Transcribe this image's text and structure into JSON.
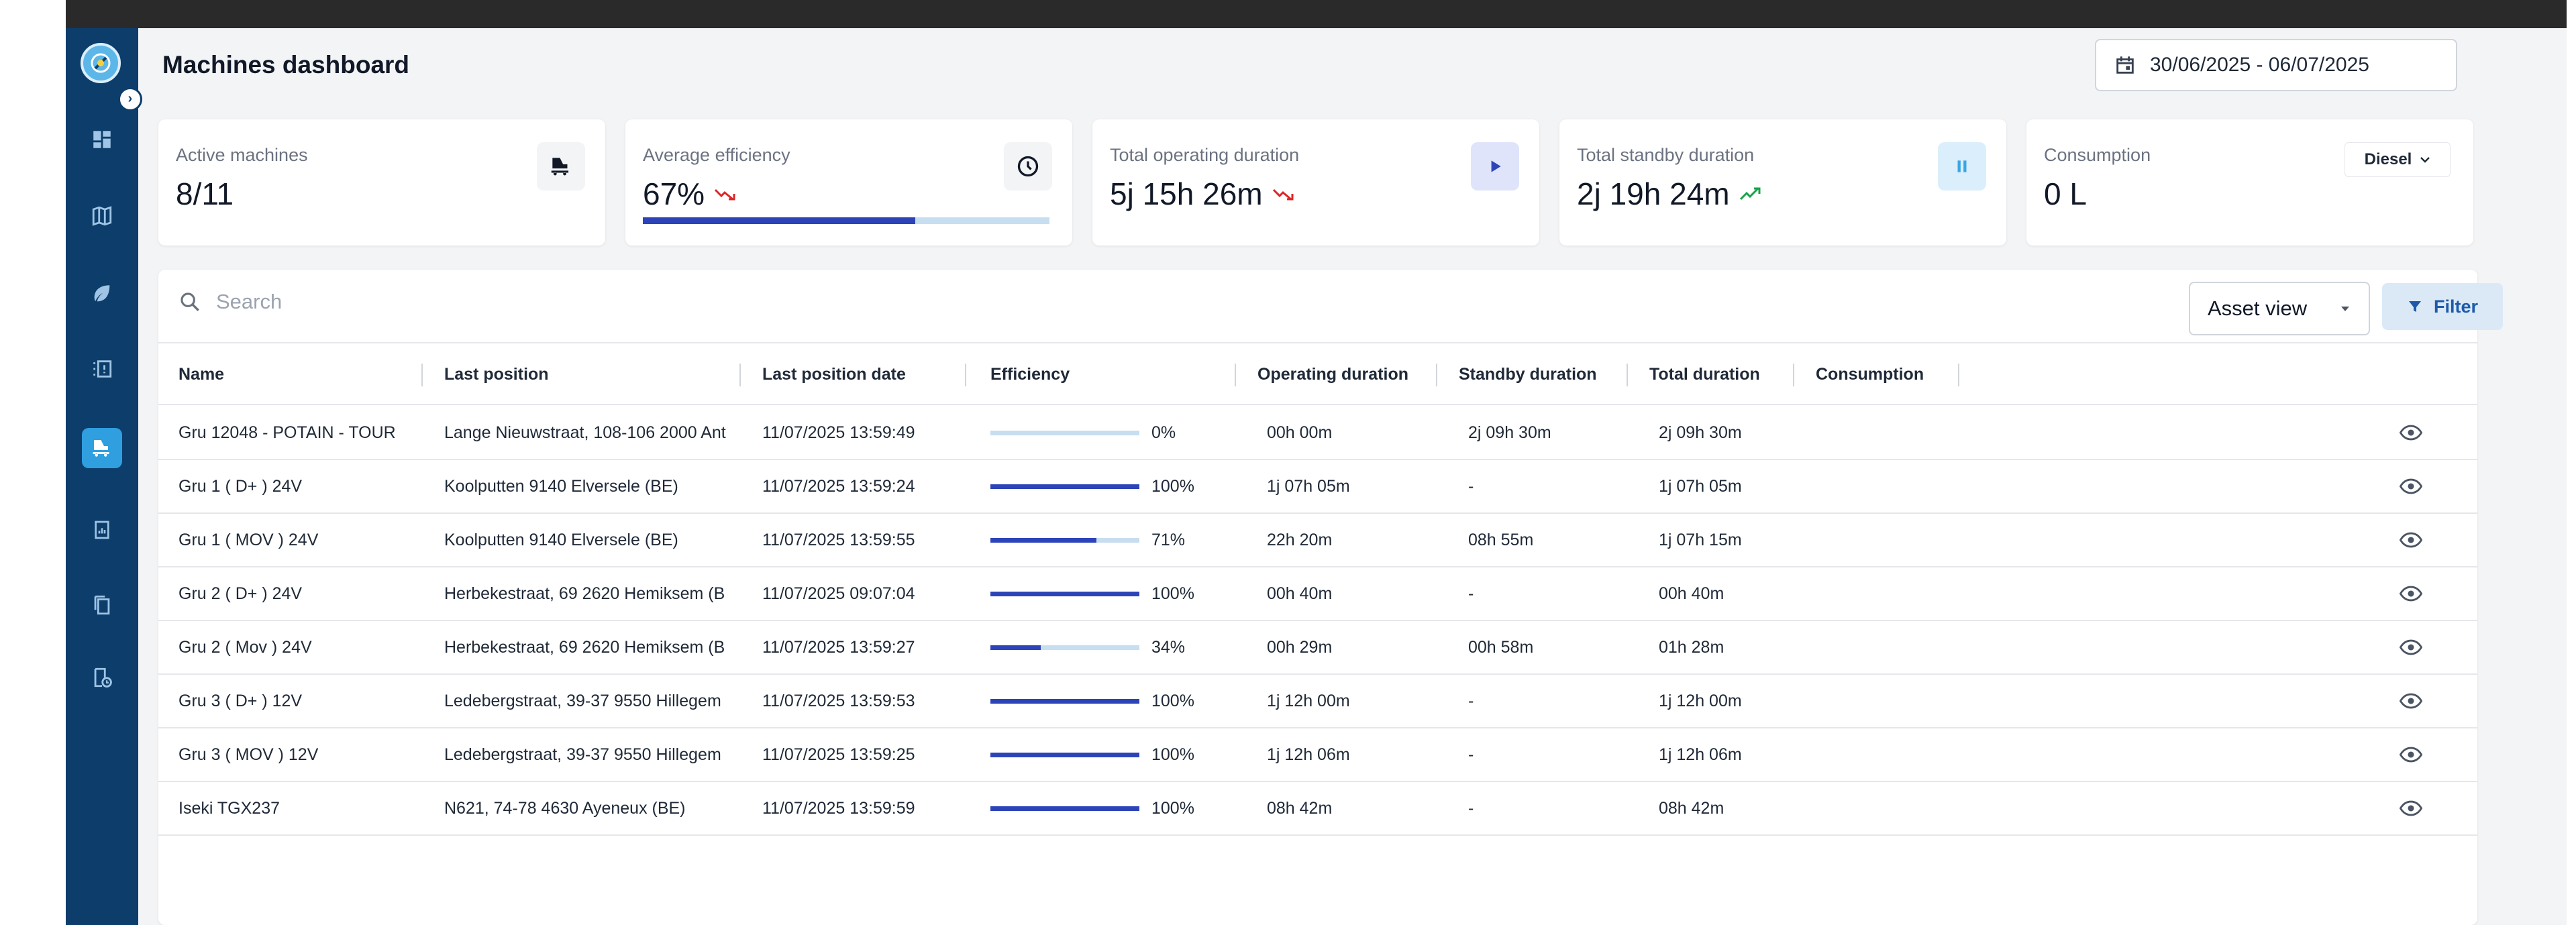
{
  "header": {
    "title": "Machines dashboard",
    "date_range": "30/06/2025 - 06/07/2025"
  },
  "sidebar": {
    "items": [
      {
        "icon": "dashboard-icon"
      },
      {
        "icon": "map-icon"
      },
      {
        "icon": "leaf-icon"
      },
      {
        "icon": "alerts-list-icon"
      },
      {
        "icon": "machines-icon",
        "active": true
      },
      {
        "icon": "report-icon"
      },
      {
        "icon": "documents-icon"
      },
      {
        "icon": "history-icon"
      }
    ]
  },
  "kpis": {
    "active_machines": {
      "label": "Active machines",
      "value": "8/11",
      "icon": "machine-icon"
    },
    "avg_efficiency": {
      "label": "Average efficiency",
      "value": "67%",
      "trend": "down",
      "icon": "clock-icon",
      "progress": 0.67
    },
    "operating": {
      "label": "Total operating duration",
      "value": "5j 15h 26m",
      "trend": "down",
      "icon": "play-icon"
    },
    "standby": {
      "label": "Total standby duration",
      "value": "2j 19h 24m",
      "trend": "up",
      "icon": "pause-icon"
    },
    "consumption": {
      "label": "Consumption",
      "value": "0 L",
      "fuel": "Diesel"
    }
  },
  "toolbar": {
    "search_placeholder": "Search",
    "view": "Asset view",
    "filter_label": "Filter"
  },
  "table": {
    "columns": [
      "Name",
      "Last position",
      "Last position date",
      "Efficiency",
      "Operating duration",
      "Standby duration",
      "Total duration",
      "Consumption"
    ],
    "rows": [
      {
        "name": "Gru 12048 - POTAIN - TOUR",
        "position": "Lange Nieuwstraat, 108-106 2000 Ant",
        "date": "11/07/2025 13:59:49",
        "efficiency": 0,
        "efficiency_label": "0%",
        "operating": "00h 00m",
        "standby": "2j 09h 30m",
        "total": "2j 09h 30m",
        "consumption": ""
      },
      {
        "name": "Gru 1 ( D+ ) 24V",
        "position": "Koolputten 9140 Elversele (BE)",
        "date": "11/07/2025 13:59:24",
        "efficiency": 100,
        "efficiency_label": "100%",
        "operating": "1j 07h 05m",
        "standby": "-",
        "total": "1j 07h 05m",
        "consumption": ""
      },
      {
        "name": "Gru 1 ( MOV ) 24V",
        "position": "Koolputten 9140 Elversele (BE)",
        "date": "11/07/2025 13:59:55",
        "efficiency": 71,
        "efficiency_label": "71%",
        "operating": "22h 20m",
        "standby": "08h 55m",
        "total": "1j 07h 15m",
        "consumption": ""
      },
      {
        "name": "Gru 2 ( D+ ) 24V",
        "position": "Herbekestraat, 69 2620 Hemiksem (BI",
        "date": "11/07/2025 09:07:04",
        "efficiency": 100,
        "efficiency_label": "100%",
        "operating": "00h 40m",
        "standby": "-",
        "total": "00h 40m",
        "consumption": ""
      },
      {
        "name": "Gru 2 ( Mov ) 24V",
        "position": "Herbekestraat, 69 2620 Hemiksem (BI",
        "date": "11/07/2025 13:59:27",
        "efficiency": 34,
        "efficiency_label": "34%",
        "operating": "00h 29m",
        "standby": "00h 58m",
        "total": "01h 28m",
        "consumption": ""
      },
      {
        "name": "Gru 3 ( D+ ) 12V",
        "position": "Ledebergstraat, 39-37 9550 Hillegem (",
        "date": "11/07/2025 13:59:53",
        "efficiency": 100,
        "efficiency_label": "100%",
        "operating": "1j 12h 00m",
        "standby": "-",
        "total": "1j 12h 00m",
        "consumption": ""
      },
      {
        "name": "Gru 3 ( MOV ) 12V",
        "position": "Ledebergstraat, 39-37 9550 Hillegem (",
        "date": "11/07/2025 13:59:25",
        "efficiency": 100,
        "efficiency_label": "100%",
        "operating": "1j 12h 06m",
        "standby": "-",
        "total": "1j 12h 06m",
        "consumption": ""
      },
      {
        "name": "Iseki TGX237",
        "position": "N621, 74-78 4630 Ayeneux (BE)",
        "date": "11/07/2025 13:59:59",
        "efficiency": 100,
        "efficiency_label": "100%",
        "operating": "08h 42m",
        "standby": "-",
        "total": "08h 42m",
        "consumption": ""
      }
    ]
  },
  "colors": {
    "sidebar": "#0c3d6b",
    "accent": "#2f9fe0",
    "bar": "#2d44b8",
    "bar_track": "#c7def0",
    "trend_down": "#dc2626",
    "trend_up": "#16a34a"
  }
}
